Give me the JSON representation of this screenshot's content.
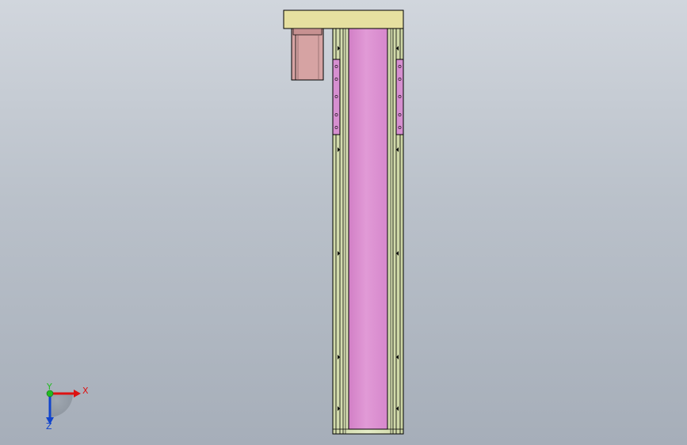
{
  "viewport": {
    "background_top": "#d1d6dd",
    "background_bottom": "#a6aeb9"
  },
  "model": {
    "top_plate_color": "#e6e0a0",
    "motor_color": "#d4a0a0",
    "rail_color": "#dfe7bf",
    "cover_color": "#d98ccc",
    "bracket_color": "#d68fd0",
    "edge_color": "#000000"
  },
  "triad": {
    "x_label": "X",
    "y_label": "Y",
    "z_label": "Z",
    "x_color": "#dd1111",
    "y_color": "#22bb22",
    "z_color": "#1144cc"
  }
}
